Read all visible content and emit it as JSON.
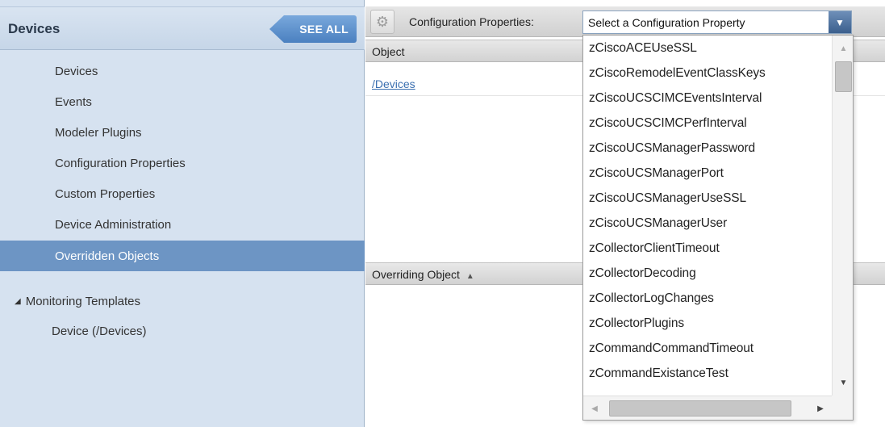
{
  "sidebar": {
    "title": "Devices",
    "see_all_label": "SEE ALL",
    "items": [
      {
        "label": "Devices"
      },
      {
        "label": "Events"
      },
      {
        "label": "Modeler Plugins"
      },
      {
        "label": "Configuration Properties"
      },
      {
        "label": "Custom Properties"
      },
      {
        "label": "Device Administration"
      },
      {
        "label": "Overridden Objects",
        "selected": true
      }
    ],
    "monitoring": {
      "label": "Monitoring Templates",
      "expand_icon": "triangle-expanded-icon",
      "items": [
        {
          "label": "Device (/Devices)"
        }
      ]
    }
  },
  "toolbar": {
    "gear_icon": "gear-icon",
    "config_label": "Configuration Properties:",
    "select_value": "Select a Configuration Property"
  },
  "grid_top": {
    "header": "Object",
    "rows": [
      {
        "label": "/Devices"
      }
    ]
  },
  "grid_bottom": {
    "header": "Overriding Object",
    "sort_icon": "sort-ascending-icon"
  },
  "dropdown": {
    "options": [
      "zCiscoACEUseSSL",
      "zCiscoRemodelEventClassKeys",
      "zCiscoUCSCIMCEventsInterval",
      "zCiscoUCSCIMCPerfInterval",
      "zCiscoUCSManagerPassword",
      "zCiscoUCSManagerPort",
      "zCiscoUCSManagerUseSSL",
      "zCiscoUCSManagerUser",
      "zCollectorClientTimeout",
      "zCollectorDecoding",
      "zCollectorLogChanges",
      "zCollectorPlugins",
      "zCommandCommandTimeout",
      "zCommandExistanceTest"
    ]
  },
  "colors": {
    "sidebar_bg": "#d6e2f0",
    "selected_bg": "#6d95c4",
    "link": "#3a6fb0",
    "see_all_bg": "#4a80c0"
  }
}
